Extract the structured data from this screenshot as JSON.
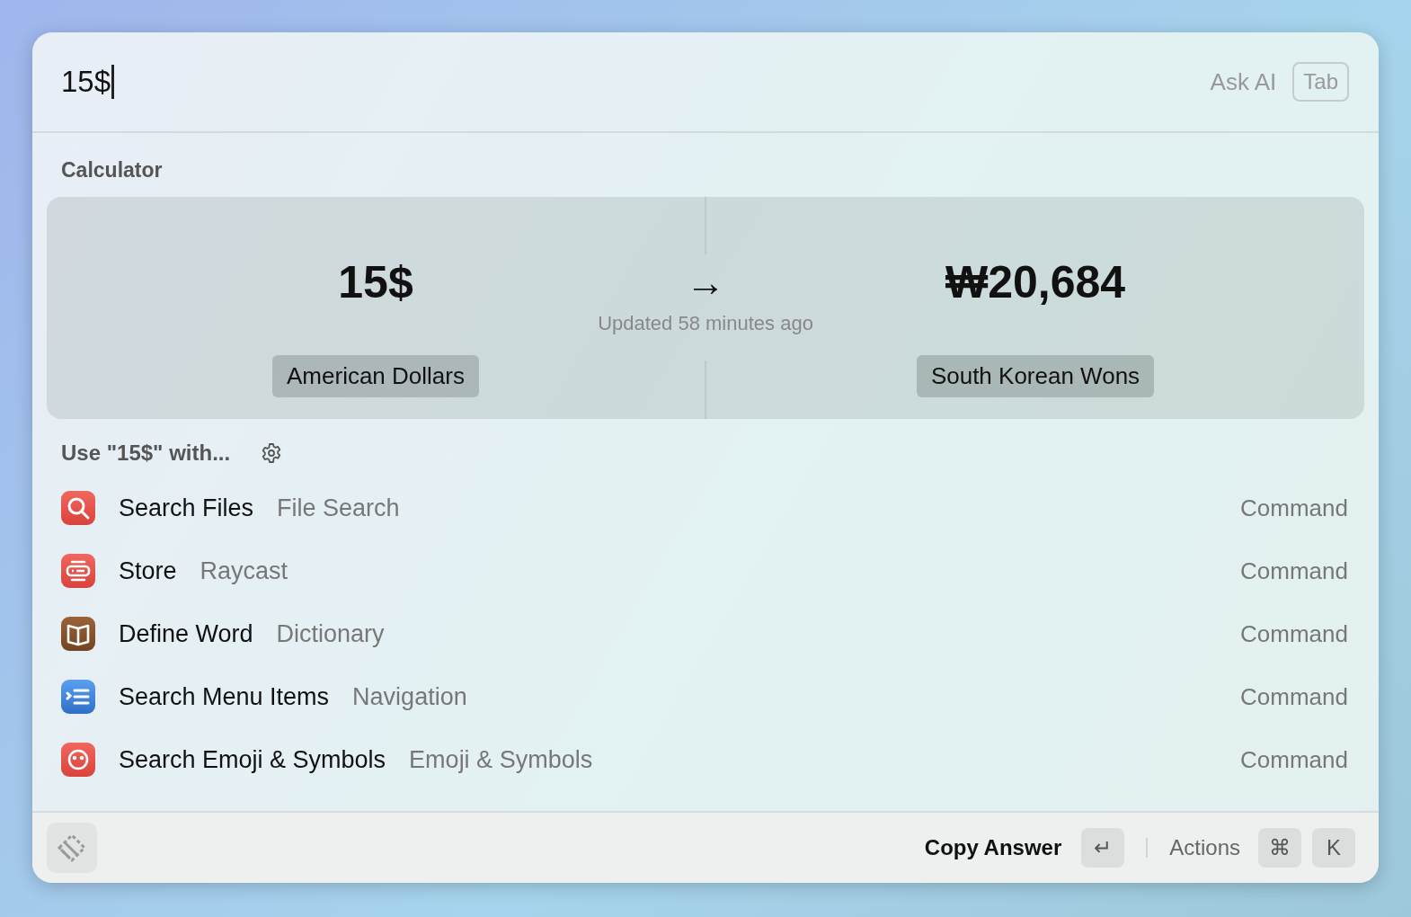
{
  "search": {
    "value": "15$"
  },
  "ask_ai": {
    "label": "Ask AI",
    "key": "Tab"
  },
  "calculator": {
    "title": "Calculator",
    "input": "15$",
    "input_unit": "American Dollars",
    "arrow": "→",
    "updated": "Updated 58 minutes ago",
    "output": "₩20,684",
    "output_unit": "South Korean Wons"
  },
  "use_with": {
    "label": "Use \"15$\" with..."
  },
  "results": [
    {
      "kind": "search",
      "title": "Search Files",
      "subtitle": "File Search",
      "type": "Command"
    },
    {
      "kind": "store",
      "title": "Store",
      "subtitle": "Raycast",
      "type": "Command"
    },
    {
      "kind": "book",
      "title": "Define Word",
      "subtitle": "Dictionary",
      "type": "Command"
    },
    {
      "kind": "menu",
      "title": "Search Menu Items",
      "subtitle": "Navigation",
      "type": "Command"
    },
    {
      "kind": "emoji",
      "title": "Search Emoji & Symbols",
      "subtitle": "Emoji & Symbols",
      "type": "Command"
    }
  ],
  "footer": {
    "primary_action": "Copy Answer",
    "primary_key": "↵",
    "actions": "Actions",
    "action_keys": [
      "⌘",
      "K"
    ]
  }
}
